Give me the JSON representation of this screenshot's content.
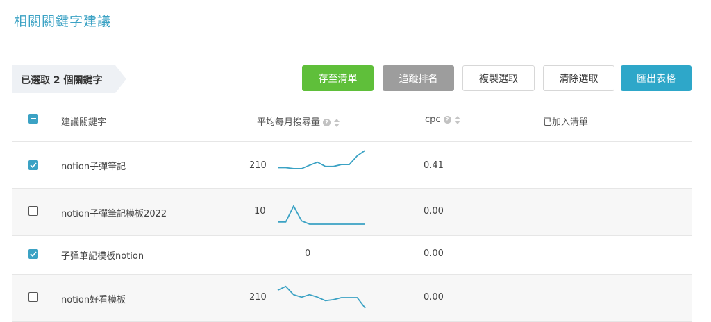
{
  "page_title": "相關關鍵字建議",
  "selection_label": "已選取 2 個關鍵字",
  "buttons": {
    "save": "存至清單",
    "track": "追蹤排名",
    "copy": "複製選取",
    "clear": "清除選取",
    "export": "匯出表格"
  },
  "table": {
    "headers": {
      "keyword": "建議關鍵字",
      "volume": "平均每月搜尋量",
      "cpc": "cpc",
      "added": "已加入清單"
    },
    "rows": [
      {
        "keyword": "notion子彈筆記",
        "volume": "210",
        "cpc": "0.41",
        "checked": true,
        "trend": [
          0.22,
          0.22,
          0.18,
          0.18,
          0.32,
          0.45,
          0.27,
          0.27,
          0.35,
          0.35,
          0.72,
          0.95
        ]
      },
      {
        "keyword": "notion子彈筆記模板2022",
        "volume": "10",
        "cpc": "0.00",
        "checked": false,
        "trend": [
          0.12,
          0.12,
          1.0,
          0.18,
          0,
          0,
          0,
          0,
          0,
          0,
          0,
          0
        ]
      },
      {
        "keyword": "子彈筆記模板notion",
        "volume": "0",
        "cpc": "0.00",
        "checked": true,
        "trend": []
      },
      {
        "keyword": "notion好看模板",
        "volume": "210",
        "cpc": "0.00",
        "checked": false,
        "trend": [
          0.8,
          0.95,
          0.62,
          0.52,
          0.62,
          0.52,
          0.38,
          0.42,
          0.5,
          0.5,
          0.5,
          0.08
        ]
      }
    ]
  },
  "colors": {
    "accent": "#3ba2c4",
    "save": "#5fbf3a",
    "track": "#9d9d9d",
    "export": "#2ea7c9",
    "sparkline": "#3ba2c4"
  }
}
